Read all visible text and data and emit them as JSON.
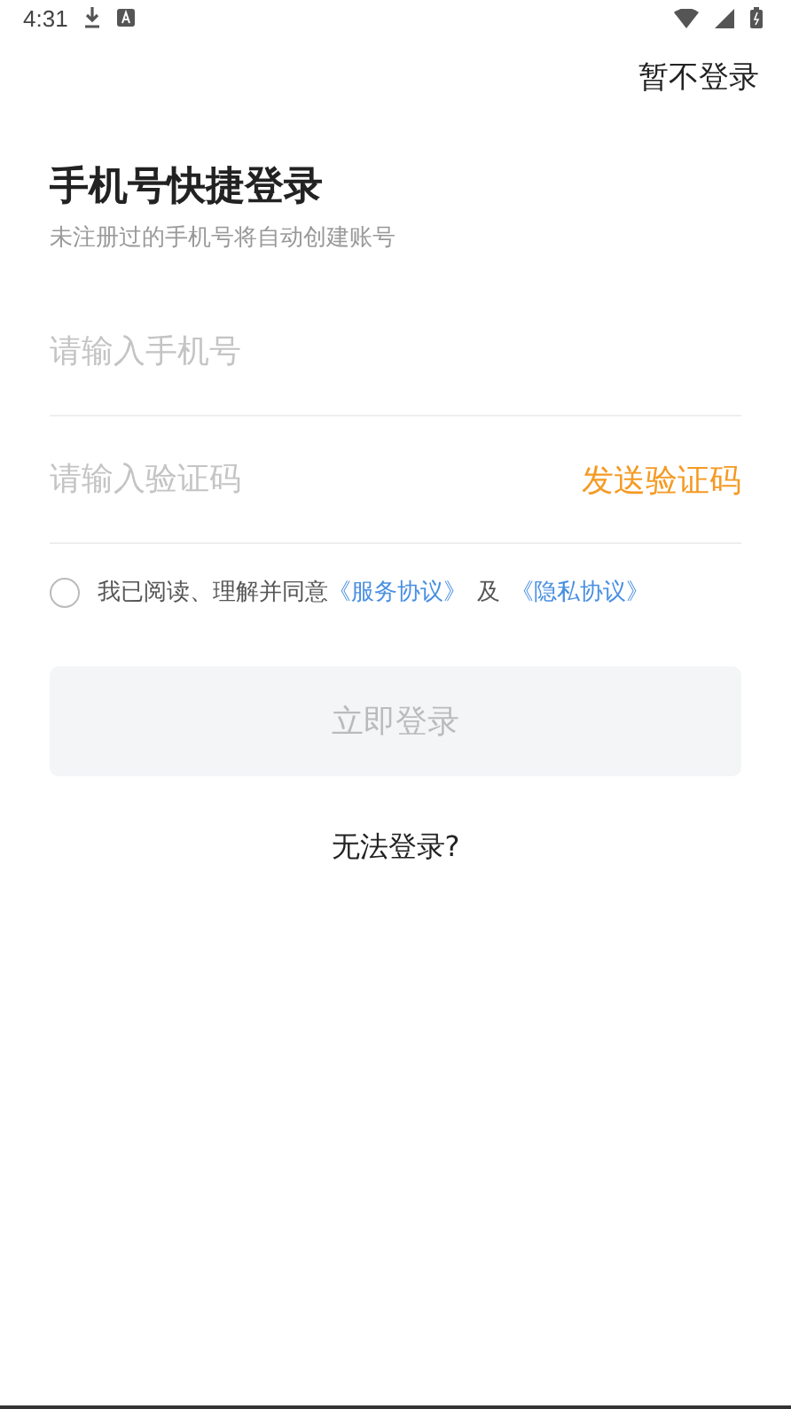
{
  "status_bar": {
    "time": "4:31"
  },
  "skip_button": "暂不登录",
  "title": "手机号快捷登录",
  "subtitle": "未注册过的手机号将自动创建账号",
  "phone_field": {
    "placeholder": "请输入手机号"
  },
  "code_field": {
    "placeholder": "请输入验证码",
    "send_button": "发送验证码"
  },
  "agreement": {
    "checked": false,
    "text": "我已阅读、理解并同意",
    "link_1": "《服务协议》",
    "joiner": "及",
    "link_2": "《隐私协议》"
  },
  "login_button": {
    "label": "立即登录",
    "disabled": true
  },
  "help_link": "无法登录?"
}
